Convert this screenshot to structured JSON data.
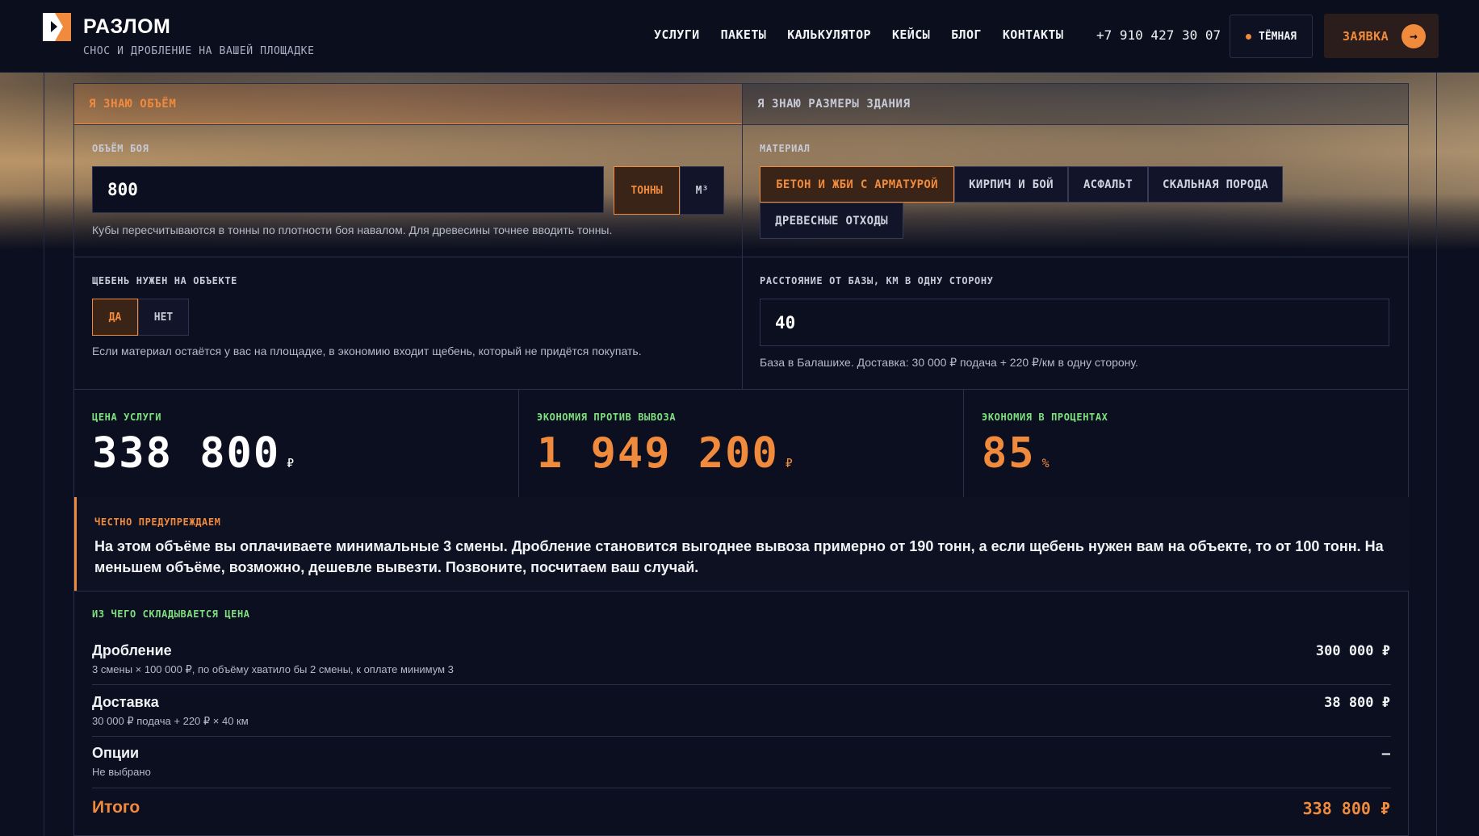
{
  "header": {
    "brand": "РАЗЛОМ",
    "tagline": "СНОС И ДРОБЛЕНИЕ НА ВАШЕЙ ПЛОЩАДКЕ",
    "nav": [
      "УСЛУГИ",
      "ПАКЕТЫ",
      "КАЛЬКУЛЯТОР",
      "КЕЙСЫ",
      "БЛОГ",
      "КОНТАКТЫ"
    ],
    "phone": "+7 910 427 30 07",
    "theme_label": "ТЁМНАЯ",
    "cta_label": "ЗАЯВКА",
    "cta_arrow": "→",
    "accent": "#f08a3c"
  },
  "tabs": {
    "volume": "Я ЗНАЮ ОБЪЁМ",
    "building": "Я ЗНАЮ РАЗМЕРЫ ЗДАНИЯ"
  },
  "volume": {
    "label": "ОБЪЁМ БОЯ",
    "value": "800",
    "unit_tons": "ТОННЫ",
    "unit_m3": "М³",
    "hint": "Кубы пересчитываются в тонны по плотности боя навалом. Для древесины точнее вводить тонны."
  },
  "material": {
    "label": "МАТЕРИАЛ",
    "options": [
      "БЕТОН И ЖБИ С АРМАТУРОЙ",
      "КИРПИЧ И БОЙ",
      "АСФАЛЬТ",
      "СКАЛЬНАЯ ПОРОДА",
      "ДРЕВЕСНЫЕ ОТХОДЫ"
    ],
    "selected": "БЕТОН И ЖБИ С АРМАТУРОЙ"
  },
  "gravel": {
    "label": "ЩЕБЕНЬ НУЖЕН НА ОБЪЕКТЕ",
    "yes": "ДА",
    "no": "НЕТ",
    "hint": "Если материал остаётся у вас на площадке, в экономию входит щебень, который не придётся покупать."
  },
  "distance": {
    "label": "РАССТОЯНИЕ ОТ БАЗЫ, КМ В ОДНУ СТОРОНУ",
    "value": "40",
    "hint": "База в Балашихе. Доставка: 30 000 ₽ подача + 220 ₽/км в одну сторону."
  },
  "stats": {
    "price_label": "ЦЕНА УСЛУГИ",
    "price_value": "338 800",
    "price_unit": "₽",
    "saving_label": "ЭКОНОМИЯ ПРОТИВ ВЫВОЗА",
    "saving_value": "1 949 200",
    "saving_unit": "₽",
    "percent_label": "ЭКОНОМИЯ В ПРОЦЕНТАХ",
    "percent_value": "85",
    "percent_unit": "%"
  },
  "warning": {
    "label": "ЧЕСТНО ПРЕДУПРЕЖДАЕМ",
    "text": "На этом объёме вы оплачиваете минимальные 3 смены. Дробление становится выгоднее вывоза примерно от 190 тонн, а если щебень нужен вам на объекте, то от 100 тонн. На меньшем объёме, возможно, дешевле вывезти. Позвоните, посчитаем ваш случай."
  },
  "breakdown": {
    "title": "ИЗ ЧЕГО СКЛАДЫВАЕТСЯ ЦЕНА",
    "rows": [
      {
        "title": "Дробление",
        "sub": "3 смены × 100 000 ₽, по объёму хватило бы 2 смены, к оплате минимум 3",
        "amount": "300 000 ₽"
      },
      {
        "title": "Доставка",
        "sub": "30 000 ₽ подача + 220 ₽ × 40 км",
        "amount": "38 800 ₽"
      },
      {
        "title": "Опции",
        "sub": "Не выбрано",
        "amount": "–"
      }
    ],
    "total_title": "Итого",
    "total_amount": "338 800 ₽"
  }
}
